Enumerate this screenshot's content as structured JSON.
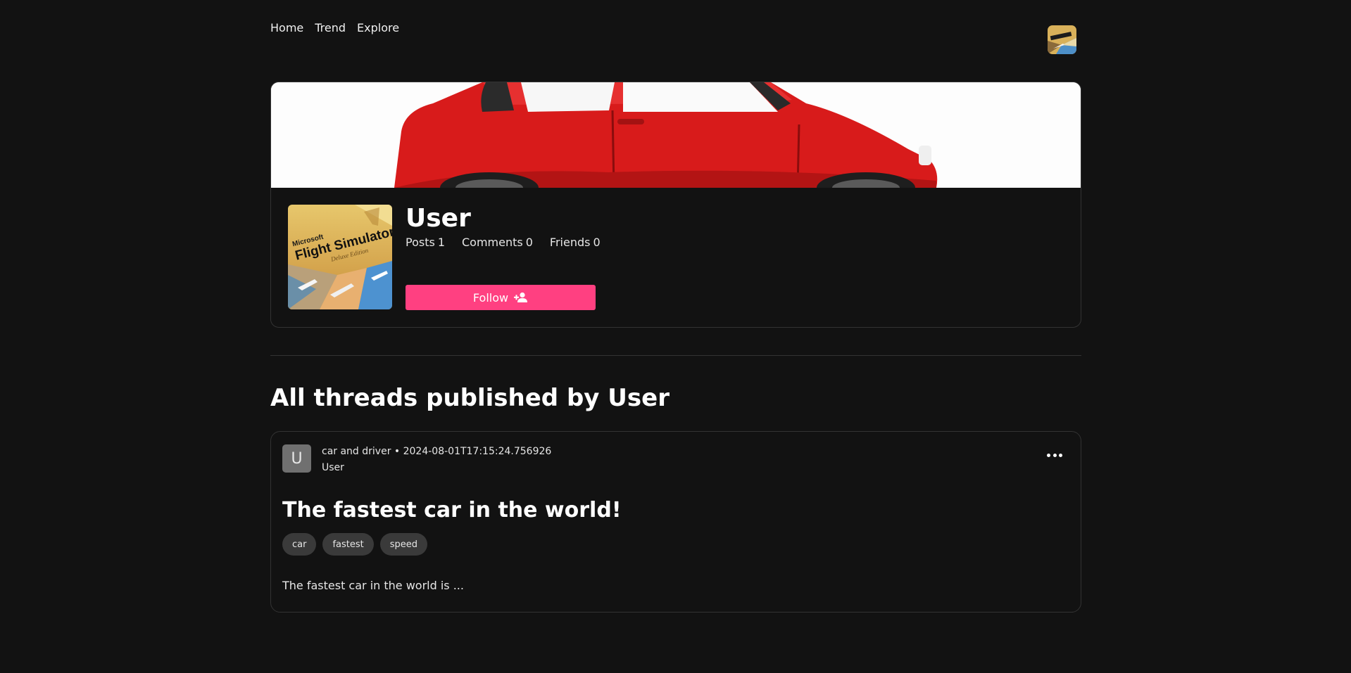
{
  "nav": {
    "items": [
      {
        "label": "Home"
      },
      {
        "label": "Trend"
      },
      {
        "label": "Explore"
      }
    ]
  },
  "profile": {
    "name": "User",
    "stats": [
      {
        "label": "Posts",
        "value": "1"
      },
      {
        "label": "Comments",
        "value": "0"
      },
      {
        "label": "Friends",
        "value": "0"
      }
    ],
    "follow_label": "Follow",
    "cover_text": {
      "brand": "Microsoft",
      "title": "Flight Simulator",
      "edition": "Deluxe Edition"
    }
  },
  "section": {
    "title": "All threads published by User"
  },
  "thread": {
    "avatar_letter": "U",
    "meta": "car and driver • 2024-08-01T17:15:24.756926",
    "author": "User",
    "title": "The fastest car in the world!",
    "tags": [
      "car",
      "fastest",
      "speed"
    ],
    "excerpt": "The fastest car in the world is ..."
  },
  "colors": {
    "background": "#121212",
    "accent": "#ff4081",
    "border": "#333333",
    "tag_bg": "#3a3a3a"
  },
  "icons": {
    "follow": "person-add-icon",
    "more": "more-horizontal-icon"
  }
}
